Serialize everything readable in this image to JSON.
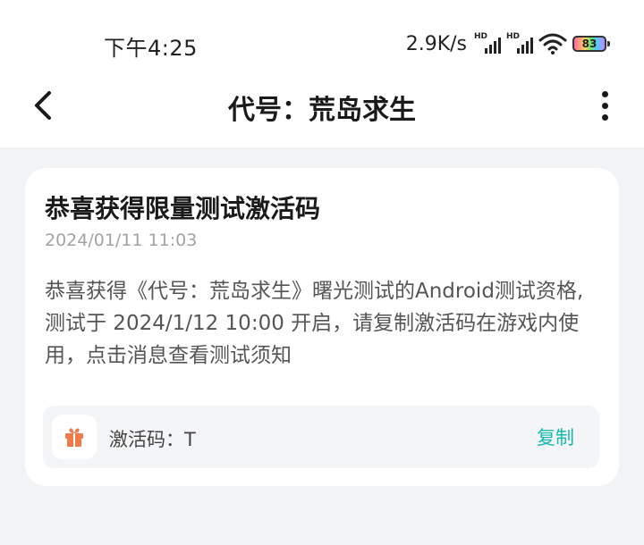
{
  "status_bar": {
    "time": "下午4:25",
    "net_speed": "2.9K/s",
    "sim1_label": "HD",
    "sim2_label": "HD",
    "battery": "83"
  },
  "nav": {
    "title": "代号：荒岛求生",
    "back_icon": "chevron-left-icon",
    "more_icon": "more-vertical-icon"
  },
  "message": {
    "title": "恭喜获得限量测试激活码",
    "time": "2024/01/11 11:03",
    "body": "恭喜获得《代号：荒岛求生》曙光测试的Android测试资格,测试于 2024/1/12 10:00 开启，请复制激活码在游戏内使用，点击消息查看测试须知",
    "code_label": "激活码：T",
    "copy_label": "复制",
    "gift_icon": "gift-icon"
  },
  "colors": {
    "accent": "#14b9b0",
    "gift": "#f07a4a",
    "background": "#f2f3f5"
  }
}
